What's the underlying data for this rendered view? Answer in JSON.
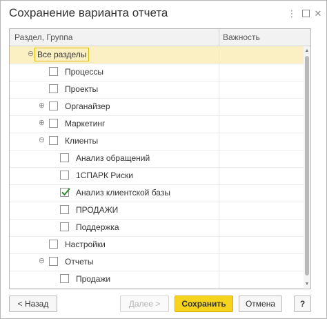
{
  "window": {
    "title": "Сохранение варианта отчета",
    "menu_icon": "more-vertical-icon",
    "maximize_icon": "maximize-icon",
    "close_icon": "close-icon"
  },
  "grid": {
    "columns": [
      "Раздел, Группа",
      "Важность"
    ],
    "rows": [
      {
        "label": "Все разделы",
        "level": 0,
        "expander": "minus",
        "checkbox": false,
        "checked": false,
        "selected": true
      },
      {
        "label": "Процессы",
        "level": 1,
        "expander": "none",
        "checkbox": true,
        "checked": false,
        "selected": false
      },
      {
        "label": "Проекты",
        "level": 1,
        "expander": "none",
        "checkbox": true,
        "checked": false,
        "selected": false
      },
      {
        "label": "Органайзер",
        "level": 1,
        "expander": "plus",
        "checkbox": true,
        "checked": false,
        "selected": false
      },
      {
        "label": "Маркетинг",
        "level": 1,
        "expander": "plus",
        "checkbox": true,
        "checked": false,
        "selected": false
      },
      {
        "label": "Клиенты",
        "level": 1,
        "expander": "minus",
        "checkbox": true,
        "checked": false,
        "selected": false
      },
      {
        "label": "Анализ обращений",
        "level": 2,
        "expander": "none",
        "checkbox": true,
        "checked": false,
        "selected": false
      },
      {
        "label": "1СПАРК Риски",
        "level": 2,
        "expander": "none",
        "checkbox": true,
        "checked": false,
        "selected": false
      },
      {
        "label": "Анализ клиентской базы",
        "level": 2,
        "expander": "none",
        "checkbox": true,
        "checked": true,
        "selected": false
      },
      {
        "label": "ПРОДАЖИ",
        "level": 2,
        "expander": "none",
        "checkbox": true,
        "checked": false,
        "selected": false
      },
      {
        "label": "Поддержка",
        "level": 2,
        "expander": "none",
        "checkbox": true,
        "checked": false,
        "selected": false
      },
      {
        "label": "Настройки",
        "level": 1,
        "expander": "none",
        "checkbox": true,
        "checked": false,
        "selected": false
      },
      {
        "label": "Отчеты",
        "level": 1,
        "expander": "minus",
        "checkbox": true,
        "checked": false,
        "selected": false
      },
      {
        "label": "Продажи",
        "level": 2,
        "expander": "none",
        "checkbox": true,
        "checked": false,
        "selected": false
      }
    ]
  },
  "footer": {
    "back_label": "< Назад",
    "next_label": "Далее >",
    "save_label": "Сохранить",
    "cancel_label": "Отмена",
    "help_label": "?"
  },
  "colors": {
    "selected_row": "#fbefc4",
    "primary_button": "#f6d41e",
    "checkmark": "#2e8b2e"
  }
}
